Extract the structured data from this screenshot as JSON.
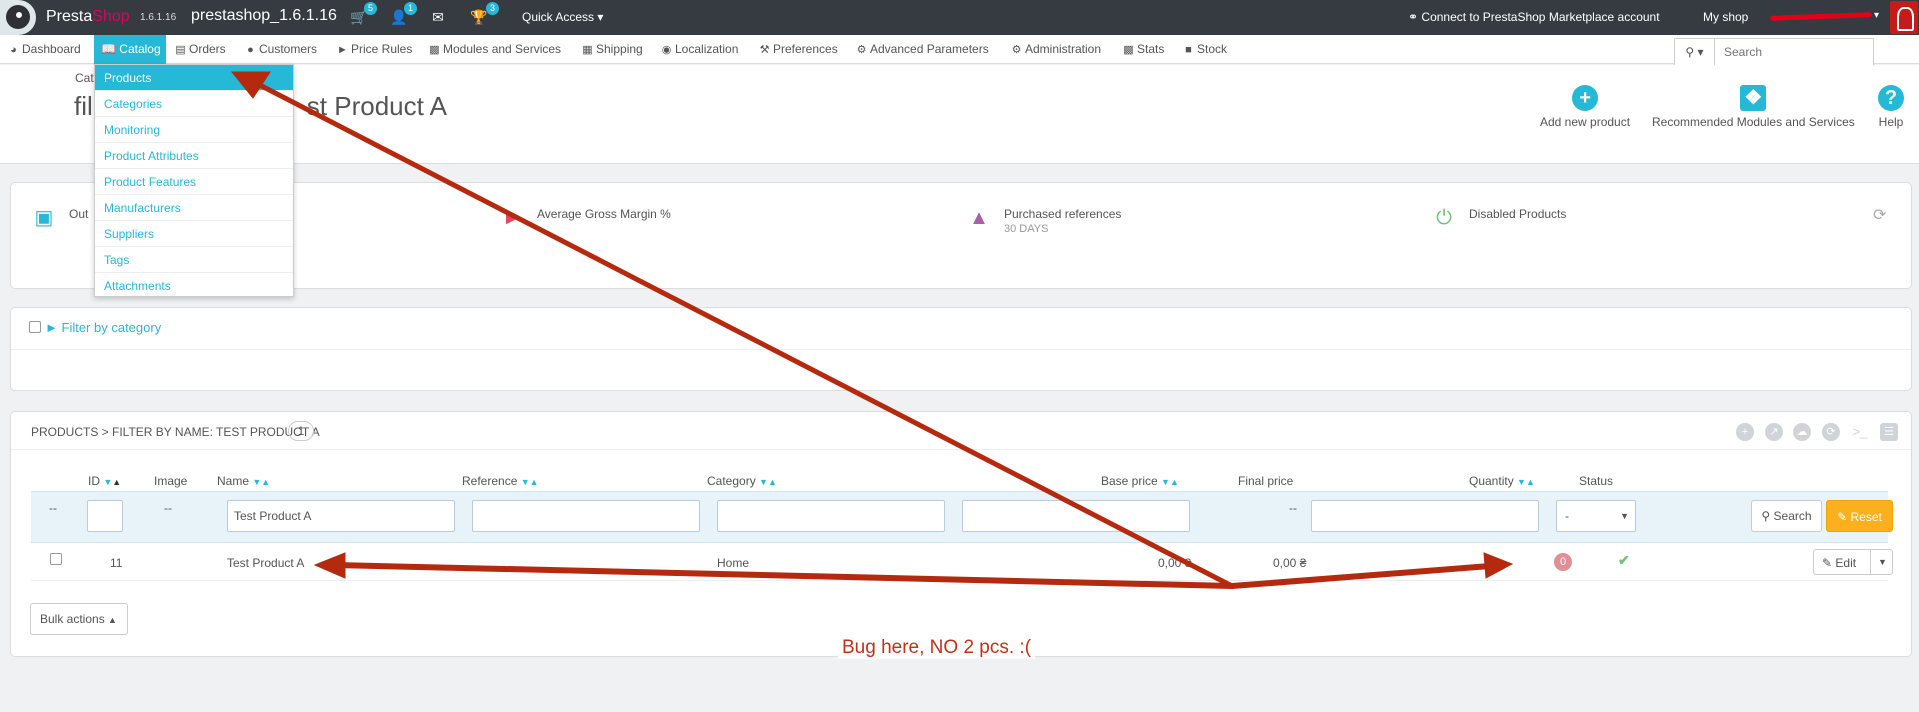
{
  "topbar": {
    "brand_presta": "Presta",
    "brand_shop": "Shop",
    "version": "1.6.1.16",
    "shop_name": "prestashop_1.6.1.16",
    "badges": {
      "orders": "5",
      "customers": "1",
      "messages": "",
      "trophy": "3"
    },
    "quick_access": "Quick Access",
    "marketplace": "Connect to PrestaShop Marketplace account",
    "my_shop": "My shop"
  },
  "nav": {
    "dashboard": "Dashboard",
    "catalog": "Catalog",
    "orders": "Orders",
    "customers": "Customers",
    "price_rules": "Price Rules",
    "modules": "Modules and Services",
    "shipping": "Shipping",
    "localization": "Localization",
    "preferences": "Preferences",
    "advanced": "Advanced Parameters",
    "administration": "Administration",
    "stats": "Stats",
    "stock": "Stock",
    "search_placeholder": "Search"
  },
  "catalog_menu": [
    "Products",
    "Categories",
    "Monitoring",
    "Product Attributes",
    "Product Features",
    "Manufacturers",
    "Suppliers",
    "Tags",
    "Attachments"
  ],
  "header": {
    "breadcrumb": "Cat",
    "title_left": "fil",
    "title_right": "st Product A",
    "add_new": "Add new product",
    "recommended": "Recommended Modules and Services",
    "help": "Help"
  },
  "kpis": {
    "out_of_stock": "Out",
    "avg_margin": "Average Gross Margin %",
    "purchased": "Purchased references",
    "purchased_sub": "30 DAYS",
    "disabled": "Disabled Products"
  },
  "filter": {
    "by_category": "Filter by category"
  },
  "products": {
    "heading": "Products > Filter by name: Test Product A",
    "count": "1",
    "columns": {
      "id": "ID",
      "image": "Image",
      "name": "Name",
      "reference": "Reference",
      "category": "Category",
      "base_price": "Base price",
      "final_price": "Final price",
      "quantity": "Quantity",
      "status": "Status"
    },
    "filters": {
      "checkbox_dash": "--",
      "image_dash": "--",
      "name_value": "Test Product A",
      "final_dash": "--",
      "status_value": "-",
      "search_label": "Search",
      "reset_label": "Reset"
    },
    "row": {
      "id": "11",
      "name": "Test Product A",
      "category": "Home",
      "base_price": "0,00 ₴",
      "final_price": "0,00 ₴",
      "quantity": "0",
      "edit_label": "Edit"
    },
    "bulk_actions": "Bulk actions"
  },
  "annotation": {
    "bug_note": "Bug here, NO 2 pcs. :(",
    "arrow_color": "#b52a0f"
  },
  "colors": {
    "accent": "#25b9d7",
    "topbar": "#363a41",
    "reset": "#fcb01d"
  }
}
